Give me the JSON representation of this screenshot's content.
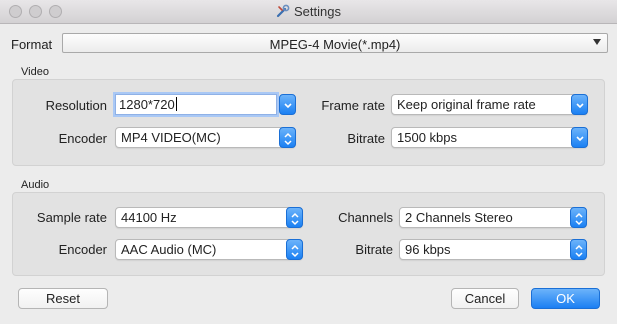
{
  "window": {
    "title": "Settings",
    "icon": "settings-app-icon"
  },
  "format": {
    "label": "Format",
    "value": "MPEG-4 Movie(*.mp4)"
  },
  "video": {
    "section_label": "Video",
    "resolution": {
      "label": "Resolution",
      "value": "1280*720"
    },
    "frame_rate": {
      "label": "Frame rate",
      "value": "Keep original frame rate"
    },
    "encoder": {
      "label": "Encoder",
      "value": "MP4 VIDEO(MC)"
    },
    "bitrate": {
      "label": "Bitrate",
      "value": "1500 kbps"
    }
  },
  "audio": {
    "section_label": "Audio",
    "sample_rate": {
      "label": "Sample rate",
      "value": "44100 Hz"
    },
    "channels": {
      "label": "Channels",
      "value": "2 Channels Stereo"
    },
    "encoder": {
      "label": "Encoder",
      "value": "AAC Audio (MC)"
    },
    "bitrate": {
      "label": "Bitrate",
      "value": "96 kbps"
    }
  },
  "buttons": {
    "reset": "Reset",
    "cancel": "Cancel",
    "ok": "OK"
  },
  "colors": {
    "accent": "#1b80f3",
    "focus_ring": "#a9c8f5"
  }
}
